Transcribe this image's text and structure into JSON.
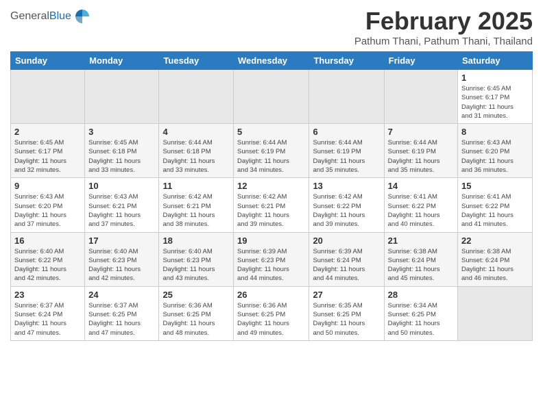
{
  "header": {
    "logo_general": "General",
    "logo_blue": "Blue",
    "month_title": "February 2025",
    "location": "Pathum Thani, Pathum Thani, Thailand"
  },
  "days_of_week": [
    "Sunday",
    "Monday",
    "Tuesday",
    "Wednesday",
    "Thursday",
    "Friday",
    "Saturday"
  ],
  "weeks": [
    {
      "days": [
        {
          "num": "",
          "info": "",
          "empty": true
        },
        {
          "num": "",
          "info": "",
          "empty": true
        },
        {
          "num": "",
          "info": "",
          "empty": true
        },
        {
          "num": "",
          "info": "",
          "empty": true
        },
        {
          "num": "",
          "info": "",
          "empty": true
        },
        {
          "num": "",
          "info": "",
          "empty": true
        },
        {
          "num": "1",
          "info": "Sunrise: 6:45 AM\nSunset: 6:17 PM\nDaylight: 11 hours\nand 31 minutes.",
          "empty": false
        }
      ]
    },
    {
      "days": [
        {
          "num": "2",
          "info": "Sunrise: 6:45 AM\nSunset: 6:17 PM\nDaylight: 11 hours\nand 32 minutes.",
          "empty": false
        },
        {
          "num": "3",
          "info": "Sunrise: 6:45 AM\nSunset: 6:18 PM\nDaylight: 11 hours\nand 33 minutes.",
          "empty": false
        },
        {
          "num": "4",
          "info": "Sunrise: 6:44 AM\nSunset: 6:18 PM\nDaylight: 11 hours\nand 33 minutes.",
          "empty": false
        },
        {
          "num": "5",
          "info": "Sunrise: 6:44 AM\nSunset: 6:19 PM\nDaylight: 11 hours\nand 34 minutes.",
          "empty": false
        },
        {
          "num": "6",
          "info": "Sunrise: 6:44 AM\nSunset: 6:19 PM\nDaylight: 11 hours\nand 35 minutes.",
          "empty": false
        },
        {
          "num": "7",
          "info": "Sunrise: 6:44 AM\nSunset: 6:19 PM\nDaylight: 11 hours\nand 35 minutes.",
          "empty": false
        },
        {
          "num": "8",
          "info": "Sunrise: 6:43 AM\nSunset: 6:20 PM\nDaylight: 11 hours\nand 36 minutes.",
          "empty": false
        }
      ]
    },
    {
      "days": [
        {
          "num": "9",
          "info": "Sunrise: 6:43 AM\nSunset: 6:20 PM\nDaylight: 11 hours\nand 37 minutes.",
          "empty": false
        },
        {
          "num": "10",
          "info": "Sunrise: 6:43 AM\nSunset: 6:21 PM\nDaylight: 11 hours\nand 37 minutes.",
          "empty": false
        },
        {
          "num": "11",
          "info": "Sunrise: 6:42 AM\nSunset: 6:21 PM\nDaylight: 11 hours\nand 38 minutes.",
          "empty": false
        },
        {
          "num": "12",
          "info": "Sunrise: 6:42 AM\nSunset: 6:21 PM\nDaylight: 11 hours\nand 39 minutes.",
          "empty": false
        },
        {
          "num": "13",
          "info": "Sunrise: 6:42 AM\nSunset: 6:22 PM\nDaylight: 11 hours\nand 39 minutes.",
          "empty": false
        },
        {
          "num": "14",
          "info": "Sunrise: 6:41 AM\nSunset: 6:22 PM\nDaylight: 11 hours\nand 40 minutes.",
          "empty": false
        },
        {
          "num": "15",
          "info": "Sunrise: 6:41 AM\nSunset: 6:22 PM\nDaylight: 11 hours\nand 41 minutes.",
          "empty": false
        }
      ]
    },
    {
      "days": [
        {
          "num": "16",
          "info": "Sunrise: 6:40 AM\nSunset: 6:22 PM\nDaylight: 11 hours\nand 42 minutes.",
          "empty": false
        },
        {
          "num": "17",
          "info": "Sunrise: 6:40 AM\nSunset: 6:23 PM\nDaylight: 11 hours\nand 42 minutes.",
          "empty": false
        },
        {
          "num": "18",
          "info": "Sunrise: 6:40 AM\nSunset: 6:23 PM\nDaylight: 11 hours\nand 43 minutes.",
          "empty": false
        },
        {
          "num": "19",
          "info": "Sunrise: 6:39 AM\nSunset: 6:23 PM\nDaylight: 11 hours\nand 44 minutes.",
          "empty": false
        },
        {
          "num": "20",
          "info": "Sunrise: 6:39 AM\nSunset: 6:24 PM\nDaylight: 11 hours\nand 44 minutes.",
          "empty": false
        },
        {
          "num": "21",
          "info": "Sunrise: 6:38 AM\nSunset: 6:24 PM\nDaylight: 11 hours\nand 45 minutes.",
          "empty": false
        },
        {
          "num": "22",
          "info": "Sunrise: 6:38 AM\nSunset: 6:24 PM\nDaylight: 11 hours\nand 46 minutes.",
          "empty": false
        }
      ]
    },
    {
      "days": [
        {
          "num": "23",
          "info": "Sunrise: 6:37 AM\nSunset: 6:24 PM\nDaylight: 11 hours\nand 47 minutes.",
          "empty": false
        },
        {
          "num": "24",
          "info": "Sunrise: 6:37 AM\nSunset: 6:25 PM\nDaylight: 11 hours\nand 47 minutes.",
          "empty": false
        },
        {
          "num": "25",
          "info": "Sunrise: 6:36 AM\nSunset: 6:25 PM\nDaylight: 11 hours\nand 48 minutes.",
          "empty": false
        },
        {
          "num": "26",
          "info": "Sunrise: 6:36 AM\nSunset: 6:25 PM\nDaylight: 11 hours\nand 49 minutes.",
          "empty": false
        },
        {
          "num": "27",
          "info": "Sunrise: 6:35 AM\nSunset: 6:25 PM\nDaylight: 11 hours\nand 50 minutes.",
          "empty": false
        },
        {
          "num": "28",
          "info": "Sunrise: 6:34 AM\nSunset: 6:25 PM\nDaylight: 11 hours\nand 50 minutes.",
          "empty": false
        },
        {
          "num": "",
          "info": "",
          "empty": true
        }
      ]
    }
  ]
}
